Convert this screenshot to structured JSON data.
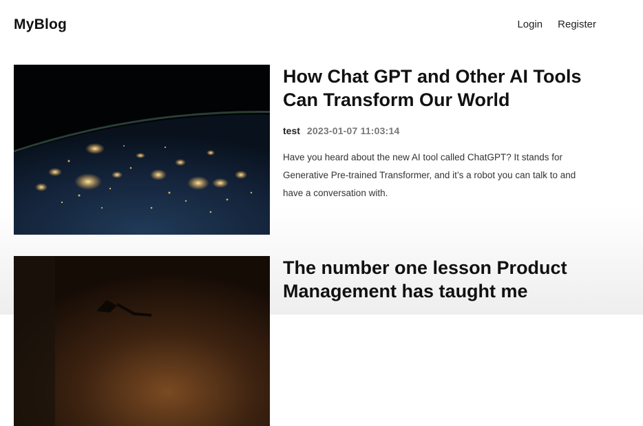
{
  "header": {
    "logo": "MyBlog",
    "nav": {
      "login": "Login",
      "register": "Register"
    }
  },
  "posts": [
    {
      "title": "How Chat GPT and Other AI Tools Can Transform Our World",
      "author": "test",
      "date": "2023-01-07 11:03:14",
      "description": "Have you heard about the new AI tool called ChatGPT? It stands for Generative Pre-trained Transformer, and it’s a robot you can talk to and have a conversation with.",
      "image": "earth-at-night-image"
    },
    {
      "title": "The number one lesson Product Management has taught me",
      "image": "dark-desk-lamp-image"
    }
  ]
}
